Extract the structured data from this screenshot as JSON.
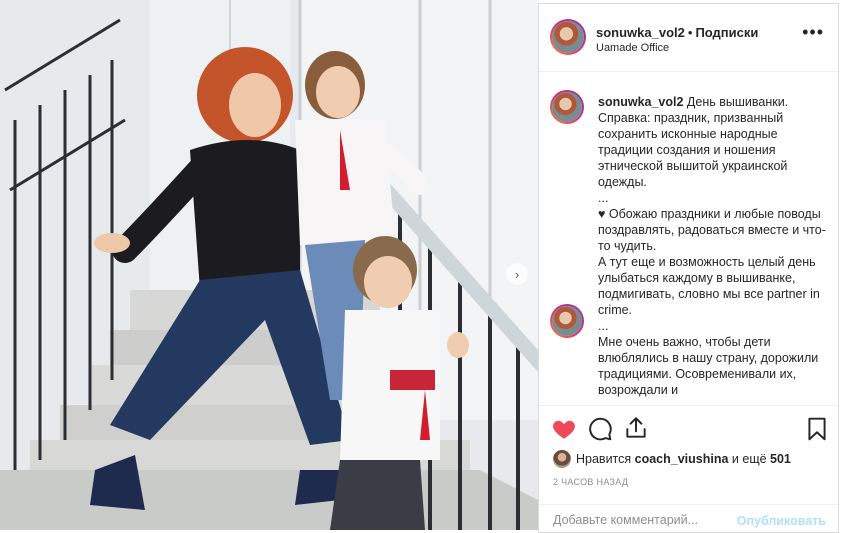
{
  "post": {
    "username": "sonuwka_vol2",
    "separator": "•",
    "follow_label": "Подписки",
    "location": "Uamade Office",
    "more_icon": "more-horizontal-icon"
  },
  "caption": {
    "username": "sonuwka_vol2",
    "text": " День вышиванки. Справка: праздник, призванный сохранить исконные народные традиции создания и ношения этнической вышитой украинской одежды.\n...\n♥ Обожаю праздники и любые поводы поздравлять, радоваться вместе и что-то чудить.\nА тут еще и возможность целый день улыбаться каждому в вышиванке, подмигивать, словно мы все partner in crime.\n...\nМне очень важно, чтобы дети влюблялись в нашу страну, дорожили традициями. Осовременивали их, возрождали и"
  },
  "actions": {
    "like_icon": "heart-filled-icon",
    "comment_icon": "comment-bubble-icon",
    "share_icon": "share-upload-icon",
    "save_icon": "bookmark-icon",
    "like_color": "#ed4956"
  },
  "likes": {
    "prefix": "Нравится ",
    "user": "coach_viushina",
    "middle": " и ещё ",
    "count": "501"
  },
  "timestamp": "2 ЧАСОВ НАЗАД",
  "comment_box": {
    "placeholder": "Добавьте комментарий...",
    "publish_label": "Опубликовать"
  },
  "colors": {
    "accent_link": "#b2dffc",
    "border": "#dbdbdb",
    "muted_text": "#8e8e8e"
  }
}
